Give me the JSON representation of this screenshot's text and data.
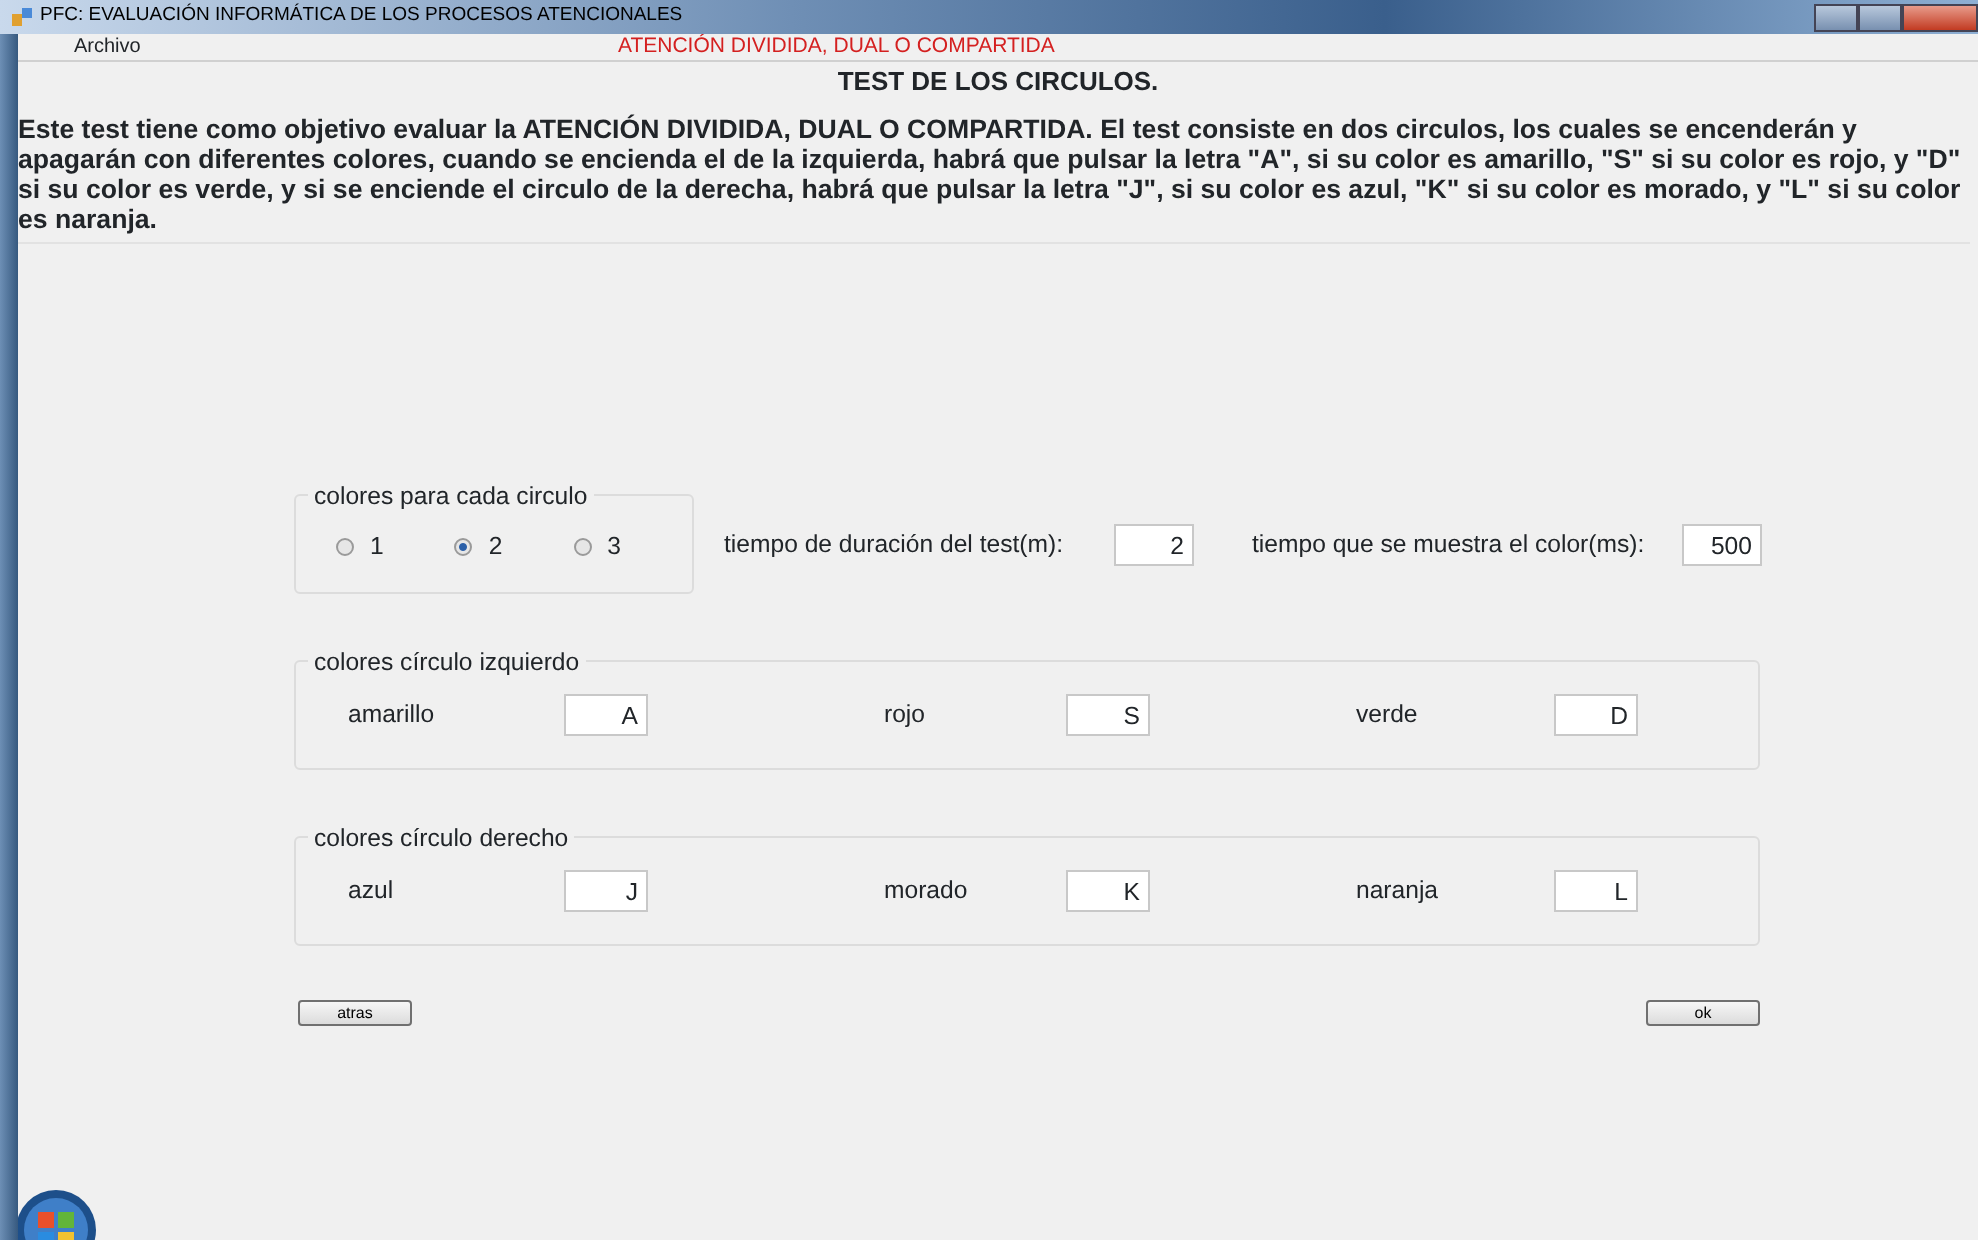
{
  "window": {
    "title": "PFC: EVALUACIÓN INFORMÁTICA DE LOS PROCESOS ATENCIONALES"
  },
  "menu": [
    {
      "label": "Archivo"
    }
  ],
  "subtitle": "ATENCIÓN DIVIDIDA, DUAL O COMPARTIDA",
  "heading": "TEST DE LOS CIRCULOS.",
  "description": "Este test  tiene como objetivo evaluar la ATENCIÓN DIVIDIDA, DUAL O COMPARTIDA. El test consiste en dos circulos, los cuales se encenderán y apagarán con diferentes colores, cuando se encienda el de la izquierda, habrá que pulsar la letra \"A\", si su color es amarillo, \"S\" si su color es rojo, y \"D\" si su color es verde, y si se enciende el circulo de la derecha, habrá que pulsar la letra \"J\", si su color es azul, \"K\" si su color es morado, y \"L\" si su color es naranja.",
  "colors_per_circle": {
    "legend": "colores para cada circulo",
    "options": [
      {
        "label": "1",
        "selected": false
      },
      {
        "label": "2",
        "selected": true
      },
      {
        "label": "3",
        "selected": false
      }
    ]
  },
  "settings": [
    {
      "label": "tiempo de duración del test(m):",
      "value": "2"
    },
    {
      "label": "tiempo que se muestra el color(ms):",
      "value": "500"
    }
  ],
  "groups": [
    {
      "legend": "colores círculo izquierdo",
      "items": [
        {
          "label": "amarillo",
          "value": "A"
        },
        {
          "label": "rojo",
          "value": "S"
        },
        {
          "label": "verde",
          "value": "D"
        }
      ]
    },
    {
      "legend": "colores círculo derecho",
      "items": [
        {
          "label": "azul",
          "value": "J"
        },
        {
          "label": "morado",
          "value": "K"
        },
        {
          "label": "naranja",
          "value": "L"
        }
      ]
    }
  ],
  "buttons": [
    {
      "label": "atras"
    },
    {
      "label": "ok"
    }
  ]
}
